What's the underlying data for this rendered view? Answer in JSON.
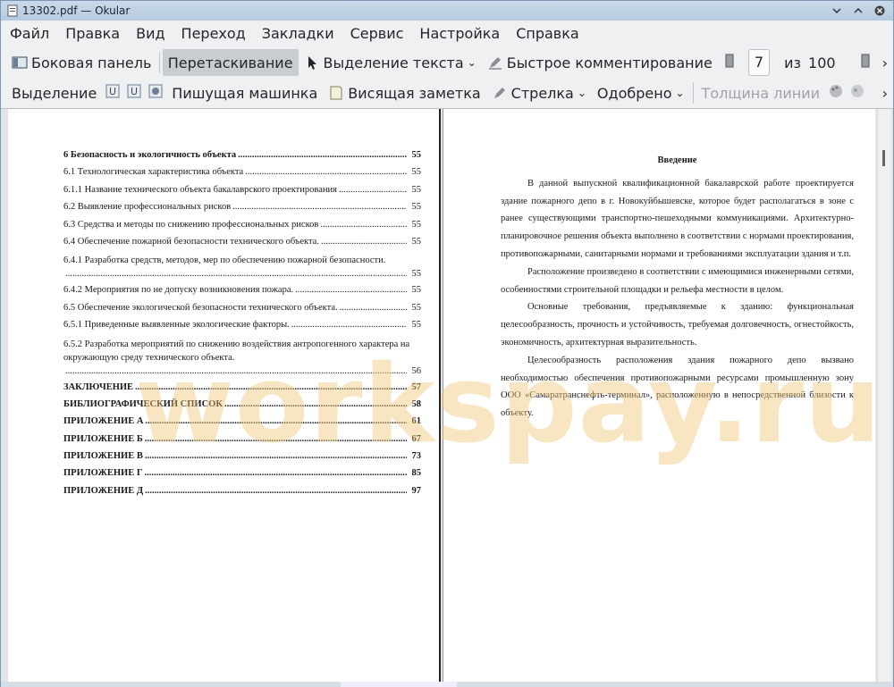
{
  "window": {
    "title": "13302.pdf  — Okular"
  },
  "menu": [
    "Файл",
    "Правка",
    "Вид",
    "Переход",
    "Закладки",
    "Сервис",
    "Настройка",
    "Справка"
  ],
  "toolbar1": {
    "sidebar": "Боковая панель",
    "drag": "Перетаскивание",
    "text_select": "Выделение текста",
    "quick_comment": "Быстрое комментирование",
    "page_current": "7",
    "page_of": "из",
    "page_total": "100"
  },
  "toolbar2": {
    "highlight": "Выделение",
    "typewriter": "Пишущая машинка",
    "note": "Висящая заметка",
    "arrow": "Стрелка",
    "approved": "Одобрено",
    "line_width": "Толщина линии"
  },
  "toc": [
    {
      "t": "6 Безопасность и экологичность объекта",
      "p": "55",
      "bold": true
    },
    {
      "t": "6.1 Технологическая характеристика объекта",
      "p": "55"
    },
    {
      "t": "6.1.1 Название технического объекта бакалаврского проектирования",
      "p": "55"
    },
    {
      "t": "6.2 Выявление профессиональных рисков",
      "p": "55"
    },
    {
      "t": "6.3 Средства и методы по снижению профессиональных рисков",
      "p": "55"
    },
    {
      "t": "6.4 Обеспечение пожарной безопасности технического объекта.",
      "p": "55"
    },
    {
      "t": "6.4.1 Разработка средств, методов, мер по обеспечению пожарной безопасности.",
      "p": "55",
      "multi": true
    },
    {
      "t": "6.4.2 Мероприятия по не допуску возникновения пожара.",
      "p": "55"
    },
    {
      "t": "6.5 Обеспечение экологической безопасности технического объекта.",
      "p": "55"
    },
    {
      "t": "6.5.1 Приведенные выявленные экологические факторы.",
      "p": "55"
    },
    {
      "t": "6.5.2 Разработка мероприятий по снижению воздействия антропогенного характера на окружающую среду технического объекта.",
      "p": "56",
      "multi2": true
    },
    {
      "t": "ЗАКЛЮЧЕНИЕ",
      "p": "57",
      "bold": true
    },
    {
      "t": "БИБЛИОГРАФИЧЕСКИЙ СПИСОК",
      "p": "58",
      "bold": true
    },
    {
      "t": "ПРИЛОЖЕНИЕ А",
      "p": "61",
      "bold": true
    },
    {
      "t": "ПРИЛОЖЕНИЕ Б",
      "p": "67",
      "bold": true
    },
    {
      "t": "ПРИЛОЖЕНИЕ В",
      "p": "73",
      "bold": true
    },
    {
      "t": "ПРИЛОЖЕНИЕ Г",
      "p": "85",
      "bold": true
    },
    {
      "t": "ПРИЛОЖЕНИЕ Д",
      "p": "97",
      "bold": true
    }
  ],
  "intro": {
    "heading": "Введение",
    "paragraphs": [
      "В данной выпускной квалификационной бакалаврской работе проектируется здание пожарного депо в г. Новокуйбышевске, которое будет располагаться в зоне с ранее существующими транспортно-пешеходными коммуникациями. Архитектурно-планировочное решения объекта выполнено в соответствии с нормами проектирования, противопожарными, санитарными нормами и требованиями эксплуатации здания и т.п.",
      "Расположение произведено в соответствии с имеющимися инженерными сетями, особенностями строительной площадки и рельефа местности в целом.",
      "Основные требования, предъявляемые к зданию: функциональная целесообразность, прочность и устойчивость, требуемая долговечность, огнестойкость, экономичность, архитектурная выразительность.",
      "Целесообразность расположения здания пожарного депо вызвано необходимостью обеспечения противопожарными ресурсами промышленную зону ООО «Самаратранснефть-терминал», расположенную в непосредственной близости к объекту."
    ]
  },
  "watermark": "workspay.ru",
  "colors": {
    "titlebar": "#c9d9ea",
    "watermark": "#f0c87a",
    "active_tool": "#c8cdd2"
  }
}
